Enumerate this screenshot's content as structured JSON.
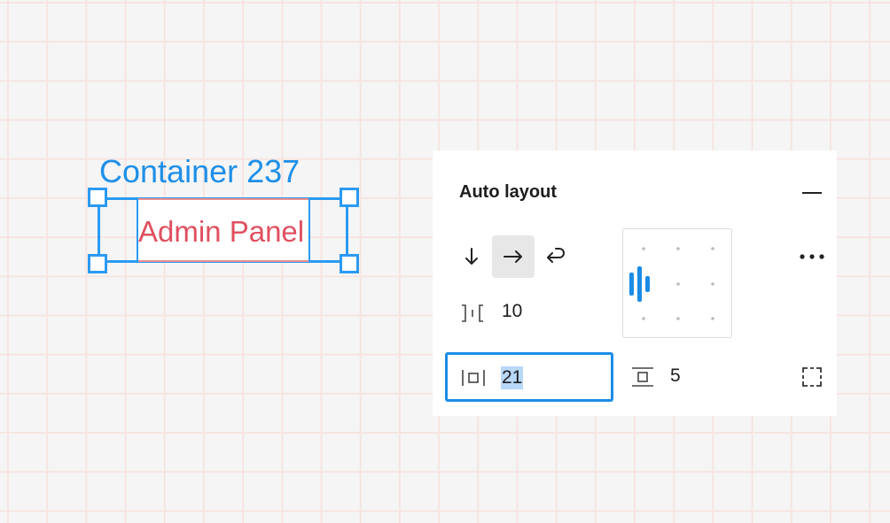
{
  "canvas": {
    "frame_name": "Container 237",
    "child_text": "Admin Panel"
  },
  "auto_layout": {
    "title": "Auto layout",
    "direction": {
      "options": [
        "vertical-arrow-icon",
        "horizontal-arrow-icon",
        "wrap-arrow-icon"
      ],
      "selected": "horizontal-arrow-icon"
    },
    "gap_between_items": "10",
    "alignment": "left-center",
    "horizontal_padding": "21",
    "vertical_padding": "5"
  },
  "colors": {
    "selection_blue": "#2b9af3",
    "child_text_red": "#e05060",
    "focus_blue": "#1b8ce6",
    "text_highlight": "#b8d8f8"
  }
}
